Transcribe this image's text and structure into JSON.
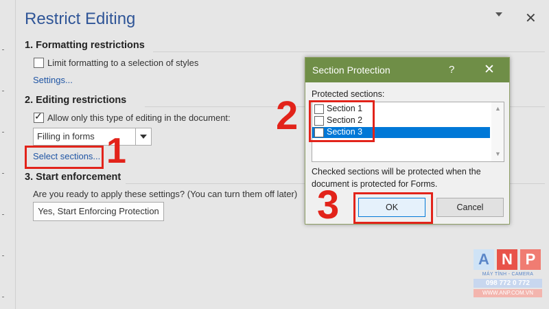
{
  "pane": {
    "title": "Restrict Editing",
    "close_glyph": "✕"
  },
  "formatting": {
    "heading": "1. Formatting restrictions",
    "checkbox_label": "Limit formatting to a selection of styles",
    "checked": false,
    "settings_link": "Settings..."
  },
  "editing": {
    "heading": "2. Editing restrictions",
    "checkbox_label": "Allow only this type of editing in the document:",
    "checked": true,
    "combo_value": "Filling in forms",
    "select_sections_link": "Select sections..."
  },
  "enforcement": {
    "heading": "3. Start enforcement",
    "question": "Are you ready to apply these settings? (You can turn them off later)",
    "button_label": "Yes, Start Enforcing Protection"
  },
  "dialog": {
    "title": "Section Protection",
    "help_glyph": "?",
    "close_glyph": "✕",
    "list_label": "Protected sections:",
    "sections": [
      {
        "label": "Section 1",
        "checked": false,
        "selected": false
      },
      {
        "label": "Section 2",
        "checked": false,
        "selected": false
      },
      {
        "label": "Section 3",
        "checked": false,
        "selected": true
      }
    ],
    "note": "Checked sections will be protected when the document is protected for Forms.",
    "ok_label": "OK",
    "cancel_label": "Cancel"
  },
  "annotations": {
    "step1": "1",
    "step2": "2",
    "step3": "3",
    "color": "#e2231a"
  },
  "watermark": {
    "letters": [
      "A",
      "N",
      "P"
    ],
    "tagline": "MÁY TÍNH - CAMERA",
    "phone": "098 772 0 772",
    "site": "WWW.ANP.COM.VN"
  },
  "colors": {
    "title_blue": "#2f5597",
    "link_blue": "#1f55a4",
    "dialog_titlebar": "#6f8e47",
    "selection": "#0078d7"
  }
}
